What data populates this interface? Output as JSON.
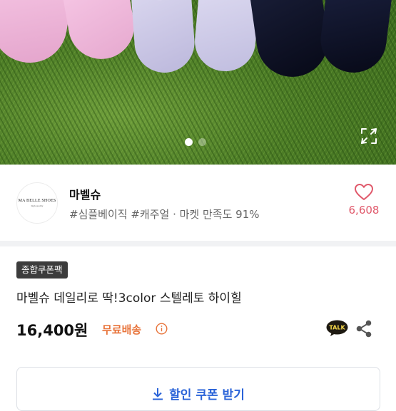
{
  "image_carousel": {
    "slide_count": 2,
    "active_index": 0,
    "expand_icon": "fullscreen-expand-icon"
  },
  "seller": {
    "logo_text": "MA BELLE SHOES",
    "logo_subtext": "high quality",
    "name": "마벨슈",
    "tags_and_satisfaction": "#심플베이직 #캐주얼 · 마켓 만족도 91%",
    "favorite_icon": "heart-icon",
    "favorite_count": "6,608"
  },
  "product": {
    "badge": "종합쿠폰팩",
    "title": "마벨슈 데일리로 딱!3color 스텔레토 하이힐",
    "price": "16,400원",
    "shipping": "무료배송",
    "info_icon": "info-circle-icon",
    "talk_icon_label": "TALK",
    "share_icon": "share-icon"
  },
  "coupon_button": {
    "icon": "download-icon",
    "label": "할인 쿠폰 받기"
  },
  "colors": {
    "accent_blue": "#2a63d8",
    "shipping_orange": "#e8743b",
    "heart_pink": "#e0596b",
    "badge_dark": "#3c3c3c",
    "talk_yellow": "#3a2d1a"
  }
}
